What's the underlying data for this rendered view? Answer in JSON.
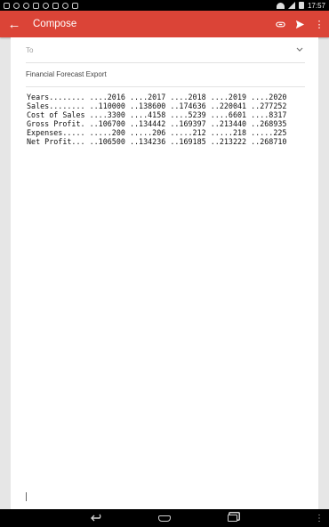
{
  "status_bar": {
    "time": "17:57",
    "icons": [
      "notification-icon",
      "alarm-icon",
      "sync-icon",
      "download-icon",
      "check-icon",
      "store-icon",
      "play-icon",
      "photo-icon",
      "wifi-icon",
      "signal-icon",
      "battery-icon"
    ]
  },
  "app_bar": {
    "title": "Compose",
    "back_icon": "←",
    "attach_icon": "⊘",
    "send_icon": "➤",
    "menu_icon": "⋮",
    "color": "#db4437"
  },
  "compose": {
    "to_placeholder": "To",
    "subject": "Financial Forecast Export",
    "body": "Years........ ....2016 ....2017 ....2018 ....2019 ....2020\nSales........ ..110000 ..138600 ..174636 ..220041 ..277252\nCost of Sales ....3300 ....4158 ....5239 ....6601 ....8317\nGross Profit. ..106700 ..134442 ..169397 ..213440 ..268935\nExpenses..... .....200 .....206 .....212 .....218 .....225\nNet Profit... ..106500 ..134236 ..169185 ..213222 ..268710"
  },
  "nav_bar": {
    "back": "⟲",
    "menu": "⋮"
  }
}
